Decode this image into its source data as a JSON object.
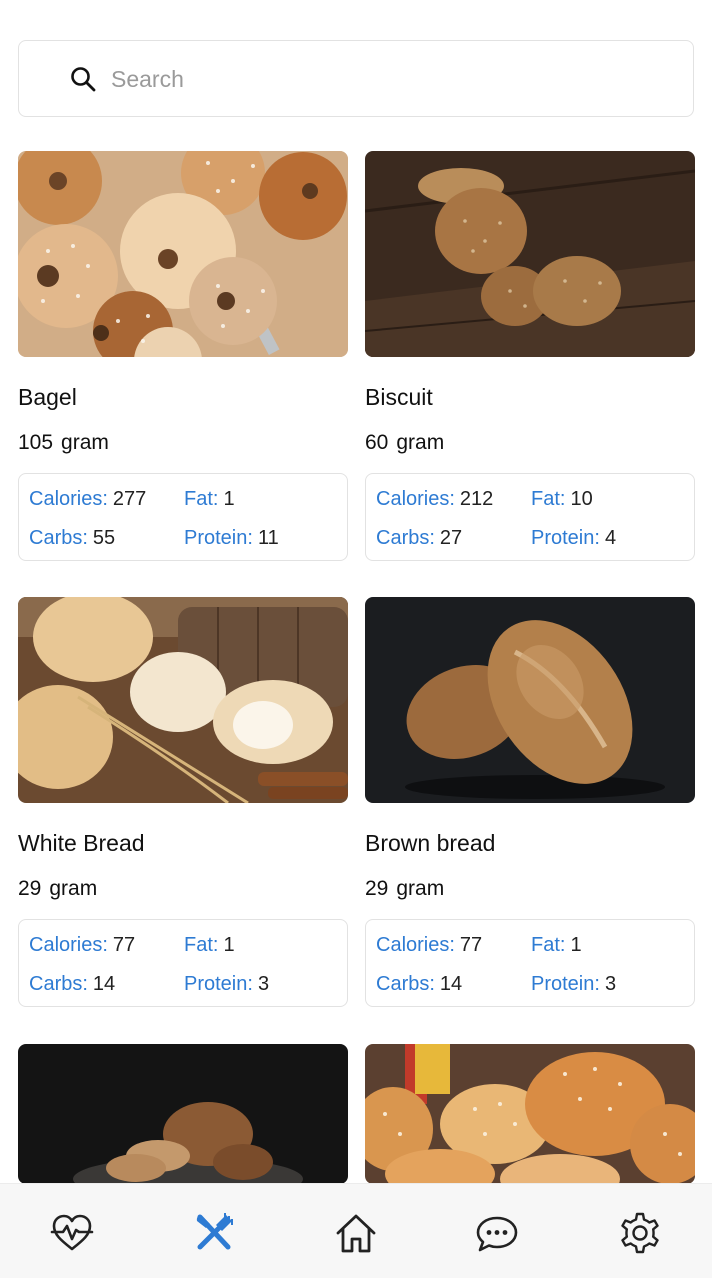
{
  "search": {
    "placeholder": "Search",
    "value": ""
  },
  "foods": [
    {
      "name": "Bagel",
      "weight": "105",
      "unit": "gram",
      "calories_label": "Calories:",
      "calories": "277",
      "fat_label": "Fat:",
      "fat": "1",
      "carbs_label": "Carbs:",
      "carbs": "55",
      "protein_label": "Protein:",
      "protein": "11"
    },
    {
      "name": "Biscuit",
      "weight": "60",
      "unit": "gram",
      "calories_label": "Calories:",
      "calories": "212",
      "fat_label": "Fat:",
      "fat": "10",
      "carbs_label": "Carbs:",
      "carbs": "27",
      "protein_label": "Protein:",
      "protein": "4"
    },
    {
      "name": "White Bread",
      "weight": "29",
      "unit": "gram",
      "calories_label": "Calories:",
      "calories": "77",
      "fat_label": "Fat:",
      "fat": "1",
      "carbs_label": "Carbs:",
      "carbs": "14",
      "protein_label": "Protein:",
      "protein": "3"
    },
    {
      "name": "Brown bread",
      "weight": "29",
      "unit": "gram",
      "calories_label": "Calories:",
      "calories": "77",
      "fat_label": "Fat:",
      "fat": "1",
      "carbs_label": "Carbs:",
      "carbs": "14",
      "protein_label": "Protein:",
      "protein": "3"
    }
  ],
  "bottom_nav": {
    "items": [
      {
        "icon": "heart-pulse-icon",
        "active": false
      },
      {
        "icon": "fork-knife-icon",
        "active": true
      },
      {
        "icon": "home-icon",
        "active": false
      },
      {
        "icon": "chat-bubble-icon",
        "active": false
      },
      {
        "icon": "gear-icon",
        "active": false
      }
    ],
    "active_color": "#2e7bd3",
    "inactive_color": "#222222"
  },
  "colors": {
    "label_blue": "#2e7bd3",
    "border": "#e2e2e2"
  }
}
